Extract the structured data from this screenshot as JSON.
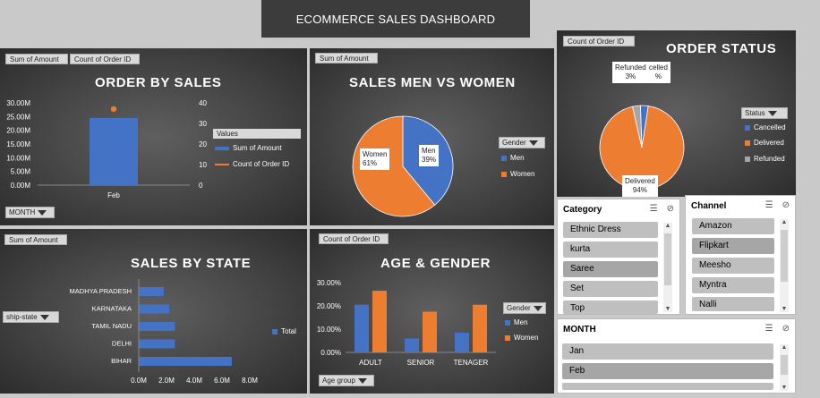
{
  "header": {
    "title": "ECOMMERCE SALES DASHBOARD"
  },
  "order_by_sales": {
    "title": "ORDER BY SALES",
    "field_buttons": [
      "Sum of Amount",
      "Count of Order ID"
    ],
    "filter_label": "MONTH",
    "legend_title": "Values",
    "legend": [
      "Sum of Amount",
      "Count of Order ID"
    ],
    "y_left_ticks": [
      "30.00M",
      "25.00M",
      "20.00M",
      "15.00M",
      "10.00M",
      "5.00M",
      "0.00M"
    ],
    "y_right_ticks": [
      "40",
      "30",
      "20",
      "10",
      "0"
    ],
    "categories": [
      "Feb"
    ]
  },
  "sales_men_women": {
    "title": "SALES MEN VS WOMEN",
    "field_button": "Sum of Amount",
    "filter_label": "Gender",
    "legend": [
      "Men",
      "Women"
    ],
    "labels": {
      "women": "Women",
      "women_pct": "61%",
      "men": "Men",
      "men_pct": "39%"
    }
  },
  "order_status": {
    "title": "ORDER STATUS",
    "field_button": "Count of Order ID",
    "filter_label": "Status",
    "legend": [
      "Cancelled",
      "Delivered",
      "Refunded"
    ],
    "labels": {
      "refunded": "Refunded",
      "refunded_pct": "3%",
      "cancelled": "celled",
      "cancelled_pct": "%",
      "delivered": "Delivered",
      "delivered_pct": "94%"
    }
  },
  "sales_by_state": {
    "title": "SALES BY STATE",
    "field_button": "Sum of Amount",
    "filter_label": "ship-state",
    "legend": [
      "Total"
    ],
    "x_ticks": [
      "0.0M",
      "2.0M",
      "4.0M",
      "6.0M",
      "8.0M"
    ]
  },
  "age_gender": {
    "title": "AGE & GENDER",
    "field_button": "Count of Order ID",
    "filter_label": "Age group",
    "legend": [
      "Men",
      "Women"
    ],
    "y_ticks": [
      "30.00%",
      "20.00%",
      "10.00%",
      "0.00%"
    ]
  },
  "slicers": {
    "category": {
      "title": "Category",
      "items": [
        "Ethnic Dress",
        "kurta",
        "Saree",
        "Set",
        "Top"
      ]
    },
    "channel": {
      "title": "Channel",
      "items": [
        "Amazon",
        "Flipkart",
        "Meesho",
        "Myntra",
        "Nalli"
      ]
    },
    "month": {
      "title": "MONTH",
      "items": [
        "Jan",
        "Feb"
      ]
    }
  },
  "colors": {
    "blue": "#4472c4",
    "orange": "#ed7d31",
    "gray": "#a5a5a5"
  },
  "chart_data": [
    {
      "type": "bar",
      "title": "ORDER BY SALES",
      "categories": [
        "Feb"
      ],
      "series": [
        {
          "name": "Sum of Amount",
          "values": [
            24500000
          ]
        },
        {
          "name": "Count of Order ID",
          "values": [
            37
          ]
        }
      ],
      "ylim": [
        0,
        30000000
      ],
      "y2lim": [
        0,
        40
      ]
    },
    {
      "type": "pie",
      "title": "SALES MEN VS WOMEN",
      "categories": [
        "Men",
        "Women"
      ],
      "values": [
        39,
        61
      ]
    },
    {
      "type": "pie",
      "title": "ORDER STATUS",
      "categories": [
        "Cancelled",
        "Delivered",
        "Refunded"
      ],
      "values": [
        3,
        94,
        3
      ]
    },
    {
      "type": "bar",
      "title": "SALES BY STATE",
      "categories": [
        "MADHYA PRADESH",
        "KARNATAKA",
        "TAMIL NADU",
        "DELHI",
        "BIHAR"
      ],
      "series": [
        {
          "name": "Total",
          "values": [
            1800000,
            2200000,
            2600000,
            2600000,
            6700000
          ]
        }
      ],
      "xlim": [
        0,
        8000000
      ]
    },
    {
      "type": "bar",
      "title": "AGE & GENDER",
      "categories": [
        "ADULT",
        "SENIOR",
        "TENAGER"
      ],
      "series": [
        {
          "name": "Men",
          "values": [
            20.5,
            6,
            8.5
          ]
        },
        {
          "name": "Women",
          "values": [
            26.5,
            17.5,
            20.5
          ]
        }
      ],
      "ylim": [
        0,
        30
      ]
    }
  ]
}
